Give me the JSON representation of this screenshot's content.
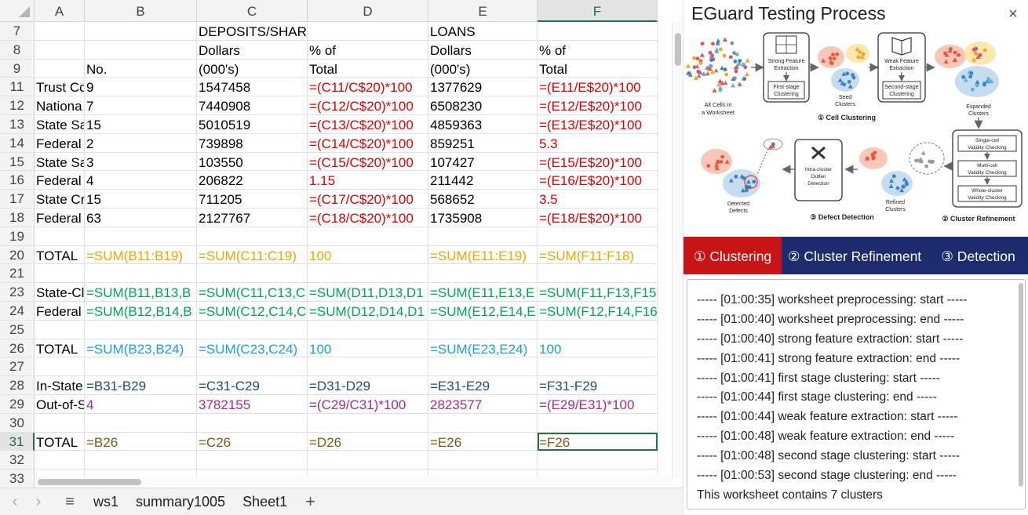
{
  "sheet": {
    "columns": [
      {
        "label": "A",
        "width": 64
      },
      {
        "label": "B",
        "width": 143
      },
      {
        "label": "C",
        "width": 141
      },
      {
        "label": "D",
        "width": 154
      },
      {
        "label": "E",
        "width": 139
      },
      {
        "label": "F",
        "width": 153
      }
    ],
    "selected_column": "F",
    "selected_row": "31",
    "rows": [
      {
        "num": "7",
        "cells": [
          "",
          "",
          "DEPOSITS/SHARES",
          "",
          "LOANS",
          ""
        ],
        "colors": [
          "#000",
          "#000",
          "#000",
          "#000",
          "#000",
          "#000"
        ]
      },
      {
        "num": "8",
        "cells": [
          "",
          "",
          "Dollars",
          "% of",
          "Dollars",
          "% of"
        ],
        "colors": [
          "#000",
          "#000",
          "#000",
          "#000",
          "#000",
          "#000"
        ]
      },
      {
        "num": "9",
        "cells": [
          "",
          "No.",
          "(000's)",
          "Total",
          "(000's)",
          "Total"
        ],
        "colors": [
          "#000",
          "#000",
          "#000",
          "#000",
          "#000",
          "#000"
        ]
      },
      {
        "num": "11",
        "cells": [
          "Trust Co",
          "9",
          "1547458",
          "=(C11/C$20)*100",
          "1377629",
          "=(E11/E$20)*100"
        ],
        "colors": [
          "#000",
          "#000",
          "#000",
          "#e00000",
          "#000",
          "#e00000"
        ]
      },
      {
        "num": "12",
        "cells": [
          "Nationa",
          "7",
          "7440908",
          "=(C12/C$20)*100",
          "6508230",
          "=(E12/E$20)*100"
        ],
        "colors": [
          "#000",
          "#000",
          "#000",
          "#e00000",
          "#000",
          "#e00000"
        ]
      },
      {
        "num": "13",
        "cells": [
          "State Sa",
          "15",
          "5010519",
          "=(C13/C$20)*100",
          "4859363",
          "=(E13/E$20)*100"
        ],
        "colors": [
          "#000",
          "#000",
          "#000",
          "#e00000",
          "#000",
          "#e00000"
        ]
      },
      {
        "num": "14",
        "cells": [
          "Federal",
          "2",
          "739898",
          "=(C14/C$20)*100",
          "859251",
          "5.3"
        ],
        "colors": [
          "#000",
          "#000",
          "#000",
          "#e00000",
          "#000",
          "#e00000"
        ]
      },
      {
        "num": "15",
        "cells": [
          "State Sa",
          "3",
          "103550",
          "=(C15/C$20)*100",
          "107427",
          "=(E15/E$20)*100"
        ],
        "colors": [
          "#000",
          "#000",
          "#000",
          "#e00000",
          "#000",
          "#e00000"
        ]
      },
      {
        "num": "16",
        "cells": [
          "Federal",
          "4",
          "206822",
          "1.15",
          "211442",
          "=(E16/E$20)*100"
        ],
        "colors": [
          "#000",
          "#000",
          "#000",
          "#e00000",
          "#000",
          "#e00000"
        ]
      },
      {
        "num": "17",
        "cells": [
          "State Cr",
          "15",
          "711205",
          "=(C17/C$20)*100",
          "568652",
          "3.5"
        ],
        "colors": [
          "#000",
          "#000",
          "#000",
          "#e00000",
          "#000",
          "#e00000"
        ]
      },
      {
        "num": "18",
        "cells": [
          "Federal",
          "63",
          "2127767",
          "=(C18/C$20)*100",
          "1735908",
          "=(E18/E$20)*100"
        ],
        "colors": [
          "#000",
          "#000",
          "#000",
          "#e00000",
          "#000",
          "#e00000"
        ]
      },
      {
        "num": "19",
        "cells": [
          "",
          "",
          "",
          "",
          "",
          ""
        ],
        "colors": [
          "#000",
          "#000",
          "#000",
          "#000",
          "#000",
          "#000"
        ]
      },
      {
        "num": "20",
        "cells": [
          "TOTAL",
          "=SUM(B11:B19)",
          "=SUM(C11:C19)",
          "100",
          "=SUM(E11:E19)",
          "=SUM(F11:F18)"
        ],
        "colors": [
          "#000",
          "#f0a500",
          "#f0a500",
          "#f0a500",
          "#f0a500",
          "#f0a500"
        ]
      },
      {
        "num": "21",
        "cells": [
          "",
          "",
          "",
          "",
          "",
          ""
        ],
        "colors": [
          "#000",
          "#000",
          "#000",
          "#000",
          "#000",
          "#000"
        ]
      },
      {
        "num": "23",
        "cells": [
          "State-Cl",
          "=SUM(B11,B13,B",
          "=SUM(C11,C13,C",
          "=SUM(D11,D13,D1",
          "=SUM(E11,E13,E",
          "=SUM(F11,F13,F15"
        ],
        "colors": [
          "#000",
          "#00a550",
          "#00a550",
          "#00a550",
          "#00a550",
          "#00a550"
        ]
      },
      {
        "num": "24",
        "cells": [
          "Federal",
          "=SUM(B12,B14,B",
          "=SUM(C12,C14,C",
          "=SUM(D12,D14,D1",
          "=SUM(E12,E14,E",
          "=SUM(F12,F14,F16"
        ],
        "colors": [
          "#000",
          "#00a550",
          "#00a550",
          "#00a550",
          "#00a550",
          "#00a550"
        ]
      },
      {
        "num": "25",
        "cells": [
          "",
          "",
          "",
          "",
          "",
          ""
        ],
        "colors": [
          "#000",
          "#000",
          "#000",
          "#000",
          "#000",
          "#000"
        ]
      },
      {
        "num": "26",
        "cells": [
          "TOTAL",
          "=SUM(B23,B24)",
          "=SUM(C23,C24)",
          "100",
          "=SUM(E23,E24)",
          "100"
        ],
        "colors": [
          "#000",
          "#1aa0dc",
          "#1aa0dc",
          "#1aa0dc",
          "#1aa0dc",
          "#1aa0dc"
        ]
      },
      {
        "num": "27",
        "cells": [
          "",
          "",
          "",
          "",
          "",
          ""
        ],
        "colors": [
          "#000",
          "#000",
          "#000",
          "#000",
          "#000",
          "#000"
        ]
      },
      {
        "num": "28",
        "cells": [
          "In-State",
          "=B31-B29",
          "=C31-C29",
          "=D31-D29",
          "=E31-E29",
          "=F31-F29"
        ],
        "colors": [
          "#000",
          "#1f4e79",
          "#1f4e79",
          "#1f4e79",
          "#1f4e79",
          "#1f4e79"
        ]
      },
      {
        "num": "29",
        "cells": [
          "Out-of-S",
          "4",
          "3782155",
          "=(C29/C31)*100",
          "2823577",
          "=(E29/E31)*100"
        ],
        "colors": [
          "#000",
          "#a02b93",
          "#a02b93",
          "#a02b93",
          "#a02b93",
          "#a02b93"
        ]
      },
      {
        "num": "30",
        "cells": [
          "",
          "",
          "",
          "",
          "",
          ""
        ],
        "colors": [
          "#000",
          "#000",
          "#000",
          "#000",
          "#000",
          "#000"
        ]
      },
      {
        "num": "31",
        "cells": [
          "TOTAL",
          "=B26",
          "=C26",
          "=D26",
          "=E26",
          "=F26"
        ],
        "colors": [
          "#000",
          "#7a5a12",
          "#7a5a12",
          "#7a5a12",
          "#7a5a12",
          "#7a5a12"
        ]
      },
      {
        "num": "32",
        "cells": [
          "",
          "",
          "",
          "",
          "",
          ""
        ],
        "colors": [
          "#000",
          "#000",
          "#000",
          "#000",
          "#000",
          "#000"
        ]
      },
      {
        "num": "33",
        "cells": [
          "",
          "",
          "",
          "",
          "",
          ""
        ],
        "colors": [
          "#000",
          "#000",
          "#000",
          "#000",
          "#000",
          "#000"
        ]
      }
    ],
    "tabs": [
      "ws1",
      "summary1005",
      "Sheet1"
    ],
    "nav_icons": [
      "chevron-left-icon",
      "chevron-right-icon",
      "hamburger-menu-icon",
      "plus-icon"
    ]
  },
  "panel": {
    "title": "EGuard Testing Process",
    "close_icon": "×",
    "diagram": {
      "all_cells_1": "All Cells in",
      "all_cells_2": "a Worksheet",
      "strong_1": "Strong Feature",
      "strong_2": "Extraction",
      "first_1": "First-stage",
      "first_2": "Clustering",
      "seed_1": "Seed",
      "seed_2": "Clusters",
      "weak_1": "Weak Feature",
      "weak_2": "Extraction",
      "second_1": "Second-stage",
      "second_2": "Clustering",
      "cell_clustering": "① Cell Clustering",
      "expanded_1": "Expanded",
      "expanded_2": "Clusters",
      "single_1": "Single-cell",
      "single_2": "Validity Checking",
      "multi_1": "Multi-cell",
      "multi_2": "Validity Checking",
      "whole_1": "Whole-cluster",
      "whole_2": "Validity Checking",
      "cluster_refinement": "② Cluster Refinement",
      "refined_1": "Refined",
      "refined_2": "Clusters",
      "intra_1": "Intra-cluster",
      "intra_2": "Outlier",
      "intra_3": "Detection",
      "detected_1": "Detected",
      "detected_2": "Defects",
      "defect_detection": "③ Defect Detection"
    },
    "tabs": [
      "① Clustering",
      "② Cluster Refinement",
      "③ Detection"
    ],
    "active_tab": 0,
    "colors": {
      "active_tab": "#c81414",
      "tab_bar": "#1c2c6e"
    },
    "log": [
      "----- [01:00:35] worksheet preprocessing: start -----",
      "----- [01:00:40] worksheet preprocessing: end -----",
      "----- [01:00:40] strong feature extraction: start -----",
      "----- [01:00:41] strong feature extraction: end -----",
      "----- [01:00:41] first stage clustering: start -----",
      "----- [01:00:44] first stage clustering: end -----",
      "----- [01:00:44] weak feature extraction: start -----",
      "----- [01:00:48] weak feature extraction: end -----",
      "----- [01:00:48] second stage clustering: start -----",
      "----- [01:00:53] second stage clustering: end -----",
      "This worksheet contains 7 clusters"
    ]
  }
}
